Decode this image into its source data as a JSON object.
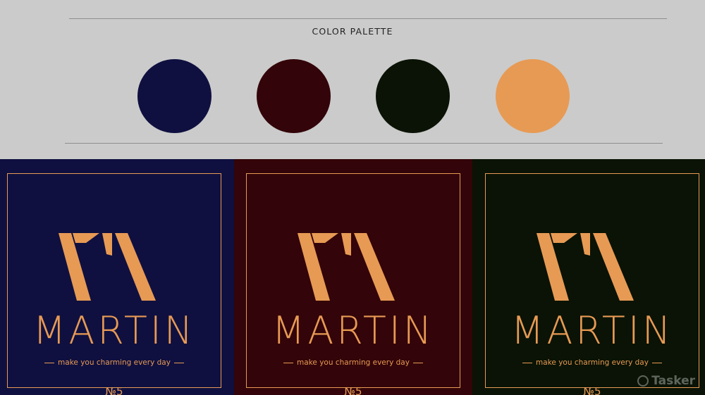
{
  "palette": {
    "title": "COLOR PALETTE",
    "swatches": [
      "#0f1040",
      "#330409",
      "#0a1305",
      "#e79a54"
    ]
  },
  "panels": [
    {
      "background": "#0f1040",
      "wordmark": "MARTIN",
      "tagline": "make you charming every day",
      "number": "№5"
    },
    {
      "background": "#330409",
      "wordmark": "MARTIN",
      "tagline": "make you charming every day",
      "number": "№5"
    },
    {
      "background": "#0a1305",
      "wordmark": "MARTIN",
      "tagline": "make you charming every day",
      "number": "№5"
    }
  ],
  "accent_color": "#e79a54",
  "watermark": "Tasker"
}
